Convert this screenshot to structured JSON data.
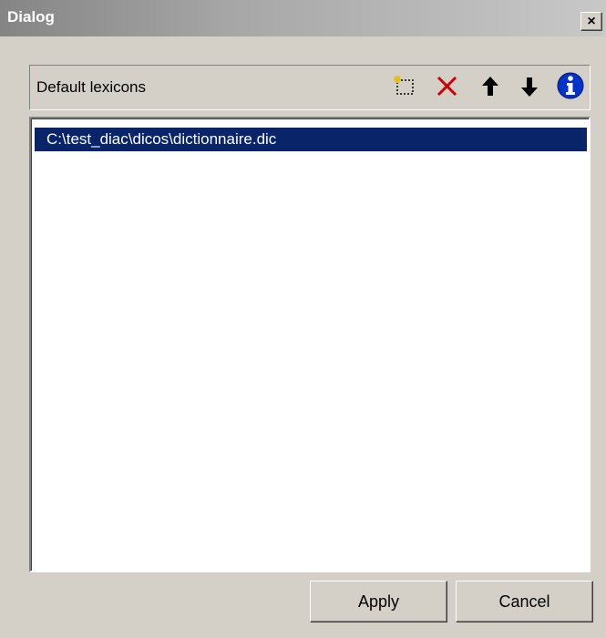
{
  "window": {
    "title": "Dialog",
    "close_glyph": "×"
  },
  "header": {
    "label": "Default lexicons",
    "icons": [
      "new-entry-icon",
      "delete-icon",
      "move-up-icon",
      "move-down-icon",
      "info-icon"
    ]
  },
  "list": {
    "items": [
      {
        "label": "C:\\test_diac\\dicos\\dictionnaire.dic",
        "selected": true
      }
    ]
  },
  "buttons": {
    "apply": "Apply",
    "cancel": "Cancel"
  },
  "colors": {
    "selection": "#0a246a",
    "delete": "#cc0000",
    "info": "#0033cc",
    "face": "#d4d0c8"
  }
}
